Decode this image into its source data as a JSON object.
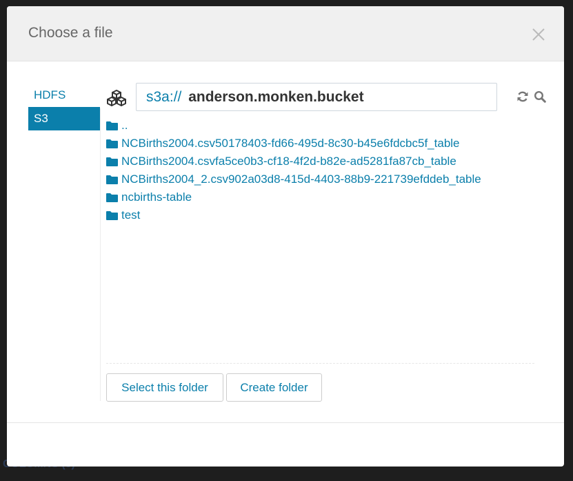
{
  "background": {
    "footer_text": "COLUMNS (5)"
  },
  "dialog": {
    "title": "Choose a file",
    "close_icon": "close-icon",
    "accent_color": "#0b7fab"
  },
  "nav": {
    "items": [
      {
        "label": "HDFS",
        "active": false
      },
      {
        "label": "S3",
        "active": true
      }
    ]
  },
  "browser": {
    "bucket_icon": "cubes-icon",
    "path": {
      "scheme": "s3a://",
      "bucket": "anderson.monken.bucket"
    },
    "refresh_icon": "refresh-icon",
    "search_icon": "search-icon",
    "entries": [
      {
        "name": "..",
        "icon": "folder-icon"
      },
      {
        "name": "NCBirths2004.csv50178403-fd66-495d-8c30-b45e6fdcbc5f_table",
        "icon": "folder-icon"
      },
      {
        "name": "NCBirths2004.csvfa5ce0b3-cf18-4f2d-b82e-ad5281fa87cb_table",
        "icon": "folder-icon"
      },
      {
        "name": "NCBirths2004_2.csv902a03d8-415d-4403-88b9-221739efddeb_table",
        "icon": "folder-icon"
      },
      {
        "name": "ncbirths-table",
        "icon": "folder-icon"
      },
      {
        "name": "test",
        "icon": "folder-icon"
      }
    ]
  },
  "actions": {
    "select_folder_label": "Select this folder",
    "create_folder_label": "Create folder"
  }
}
